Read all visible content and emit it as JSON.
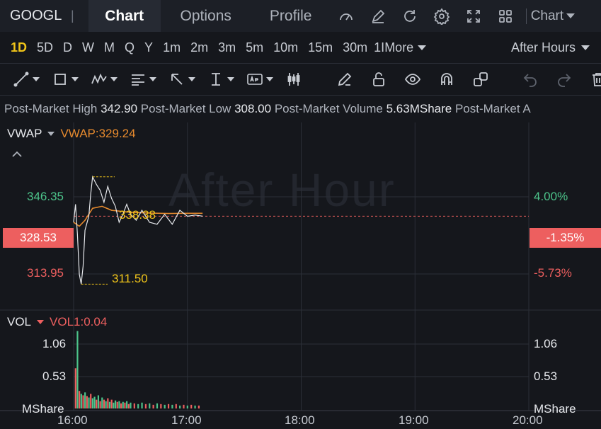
{
  "header": {
    "ticker": "GOOGL",
    "separator": "|",
    "tabs": [
      {
        "label": "Chart",
        "active": true
      },
      {
        "label": "Options",
        "active": false
      },
      {
        "label": "Profile",
        "active": false
      }
    ],
    "chart_type_label": "Chart"
  },
  "intervals": {
    "items": [
      "1D",
      "5D",
      "D",
      "W",
      "M",
      "Q",
      "Y",
      "1m",
      "2m",
      "3m",
      "5m",
      "10m",
      "15m",
      "30m",
      "1I"
    ],
    "active": "1D",
    "more_label": "More",
    "session_label": "After Hours"
  },
  "post_market": {
    "high_label": "Post-Market High",
    "high_value": "342.90",
    "low_label": "Post-Market Low",
    "low_value": "308.00",
    "volume_label": "Post-Market Volume",
    "volume_value": "5.63MShare",
    "extra_label": "Post-Market A"
  },
  "indicators": {
    "main_name": "VWAP",
    "main_value": "VWAP:329.24",
    "vol_name": "VOL",
    "vol_value": "VOL1:0.04"
  },
  "watermark": "After Hour",
  "colors": {
    "accent_yellow": "#f0c419",
    "up": "#4cc38a",
    "down": "#ed5f5f",
    "vwap": "#e68a2e",
    "background": "#15171c"
  },
  "chart_data": {
    "type": "line",
    "price_axis_left": [
      "346.35",
      "313.95"
    ],
    "current_price": "328.53",
    "pct_axis_right": [
      "4.00%",
      "-5.73%"
    ],
    "current_pct": "-1.35%",
    "annotations": {
      "high": "338.38",
      "low": "311.50"
    },
    "x_tick_labels": [
      "16:00",
      "17:00",
      "18:00",
      "19:00",
      "20:00"
    ],
    "price_series": {
      "x_minutes": [
        0,
        1,
        2,
        3,
        4,
        5,
        6,
        8,
        9,
        10,
        12,
        14,
        16,
        18,
        20,
        22,
        24,
        26,
        28,
        30,
        33,
        36,
        40,
        44,
        48,
        52,
        56,
        60,
        64,
        68
      ],
      "y": [
        327.0,
        331.5,
        324.0,
        314.0,
        311.5,
        316.0,
        325.0,
        328.5,
        334.0,
        338.38,
        336.5,
        335.0,
        332.0,
        336.0,
        333.0,
        331.0,
        327.0,
        329.0,
        331.5,
        329.0,
        327.5,
        330.0,
        327.0,
        326.5,
        329.0,
        326.5,
        330.0,
        328.5,
        328.8,
        328.53
      ]
    },
    "vwap_series": {
      "x_minutes": [
        0,
        3,
        6,
        10,
        15,
        20,
        30,
        40,
        50,
        60,
        68
      ],
      "y": [
        327.0,
        326.0,
        327.5,
        330.5,
        331.0,
        330.0,
        329.5,
        329.3,
        329.2,
        329.25,
        329.24
      ]
    },
    "volume_axis": [
      "1.06",
      "0.53",
      "MShare"
    ],
    "volume_series": {
      "x_minutes": [
        1,
        2,
        3,
        4,
        5,
        6,
        7,
        8,
        9,
        10,
        11,
        12,
        13,
        14,
        15,
        16,
        17,
        18,
        19,
        20,
        21,
        22,
        23,
        24,
        25,
        26,
        27,
        28,
        29,
        30,
        32,
        34,
        36,
        38,
        40,
        42,
        44,
        46,
        48,
        50,
        52,
        54,
        56,
        58,
        60,
        62,
        64,
        66
      ],
      "values": [
        0.55,
        1.06,
        0.24,
        0.2,
        0.18,
        0.22,
        0.17,
        0.15,
        0.2,
        0.14,
        0.16,
        0.12,
        0.18,
        0.1,
        0.15,
        0.12,
        0.1,
        0.14,
        0.09,
        0.12,
        0.08,
        0.11,
        0.09,
        0.1,
        0.07,
        0.09,
        0.08,
        0.1,
        0.06,
        0.08,
        0.07,
        0.06,
        0.08,
        0.06,
        0.07,
        0.05,
        0.07,
        0.06,
        0.05,
        0.06,
        0.05,
        0.06,
        0.04,
        0.05,
        0.04,
        0.05,
        0.04,
        0.04
      ],
      "up": [
        false,
        true,
        false,
        true,
        false,
        true,
        false,
        true,
        false,
        true,
        true,
        false,
        true,
        false,
        true,
        false,
        true,
        false,
        true,
        false,
        true,
        true,
        false,
        true,
        false,
        true,
        false,
        true,
        false,
        true,
        false,
        true,
        true,
        false,
        true,
        false,
        true,
        false,
        true,
        false,
        true,
        false,
        true,
        false,
        true,
        false,
        true,
        false
      ]
    },
    "price_ylim": [
      305.0,
      352.0
    ],
    "volume_ylim": [
      0,
      1.25
    ],
    "x_range_minutes": [
      0,
      240
    ],
    "grid": true
  }
}
